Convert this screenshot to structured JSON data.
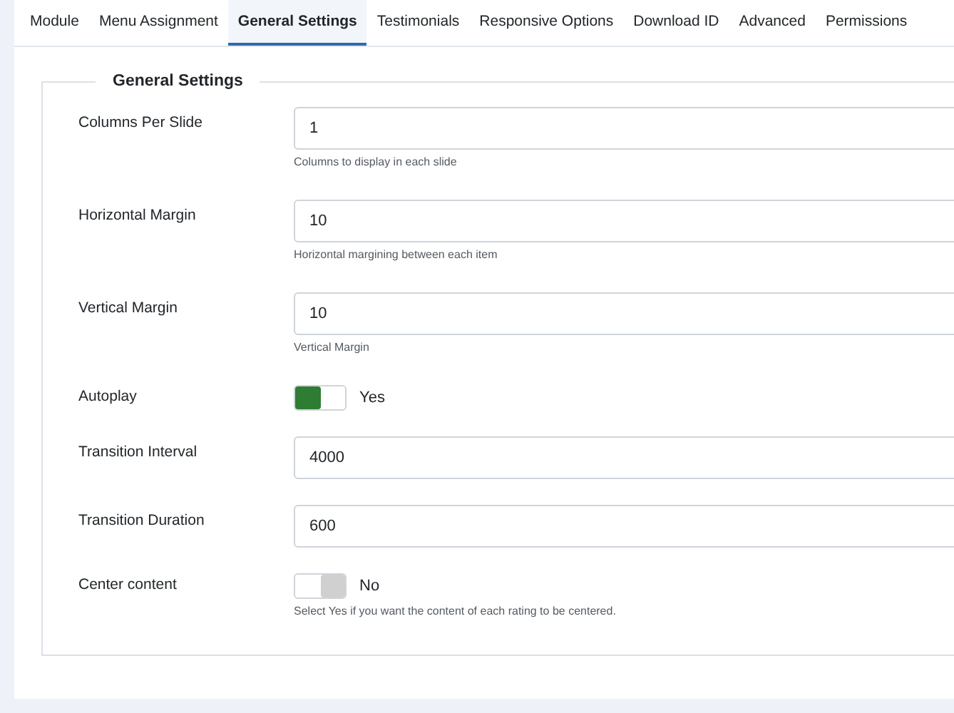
{
  "tabs": [
    {
      "label": "Module",
      "selected": false
    },
    {
      "label": "Menu Assignment",
      "selected": false
    },
    {
      "label": "General Settings",
      "selected": true
    },
    {
      "label": "Testimonials",
      "selected": false
    },
    {
      "label": "Responsive Options",
      "selected": false
    },
    {
      "label": "Download ID",
      "selected": false
    },
    {
      "label": "Advanced",
      "selected": false
    },
    {
      "label": "Permissions",
      "selected": false
    }
  ],
  "fieldset": {
    "legend": "General Settings",
    "fields": [
      {
        "kind": "text",
        "label": "Columns Per Slide",
        "value": "1",
        "hint": "Columns to display in each slide"
      },
      {
        "kind": "text",
        "label": "Horizontal Margin",
        "value": "10",
        "hint": "Horizontal margining between each item"
      },
      {
        "kind": "text",
        "label": "Vertical Margin",
        "value": "10",
        "hint": "Vertical Margin"
      },
      {
        "kind": "toggle",
        "label": "Autoplay",
        "on": true,
        "state_text": "Yes"
      },
      {
        "kind": "text",
        "label": "Transition Interval",
        "value": "4000"
      },
      {
        "kind": "text",
        "label": "Transition Duration",
        "value": "600"
      },
      {
        "kind": "toggle",
        "label": "Center content",
        "on": false,
        "state_text": "No",
        "hint": "Select Yes if you want the content of each rating to be centered."
      }
    ]
  }
}
